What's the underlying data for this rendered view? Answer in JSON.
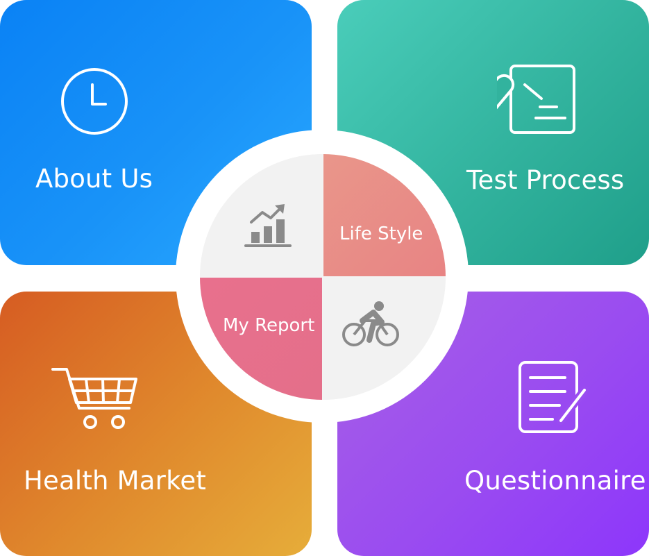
{
  "tiles": {
    "about": {
      "label": "About Us",
      "icon": "clock-icon"
    },
    "test": {
      "label": "Test Process",
      "icon": "test-tube-document-icon"
    },
    "health": {
      "label": "Health Market",
      "icon": "shopping-cart-icon"
    },
    "questionnaire": {
      "label": "Questionnaire",
      "icon": "document-pencil-icon"
    }
  },
  "hub": {
    "top_left": {
      "icon": "growth-chart-icon"
    },
    "top_right": {
      "label": "Life Style"
    },
    "bottom_left": {
      "label": "My Report"
    },
    "bottom_right": {
      "icon": "cyclist-icon"
    }
  },
  "colors": {
    "about": "#1993f8",
    "test": "#32b39e",
    "health": "#e08a2d",
    "questionnaire": "#9a4cf0",
    "life_style": "#e88c86",
    "my_report": "#e6708b",
    "icon_gray": "#8a8a8a"
  }
}
